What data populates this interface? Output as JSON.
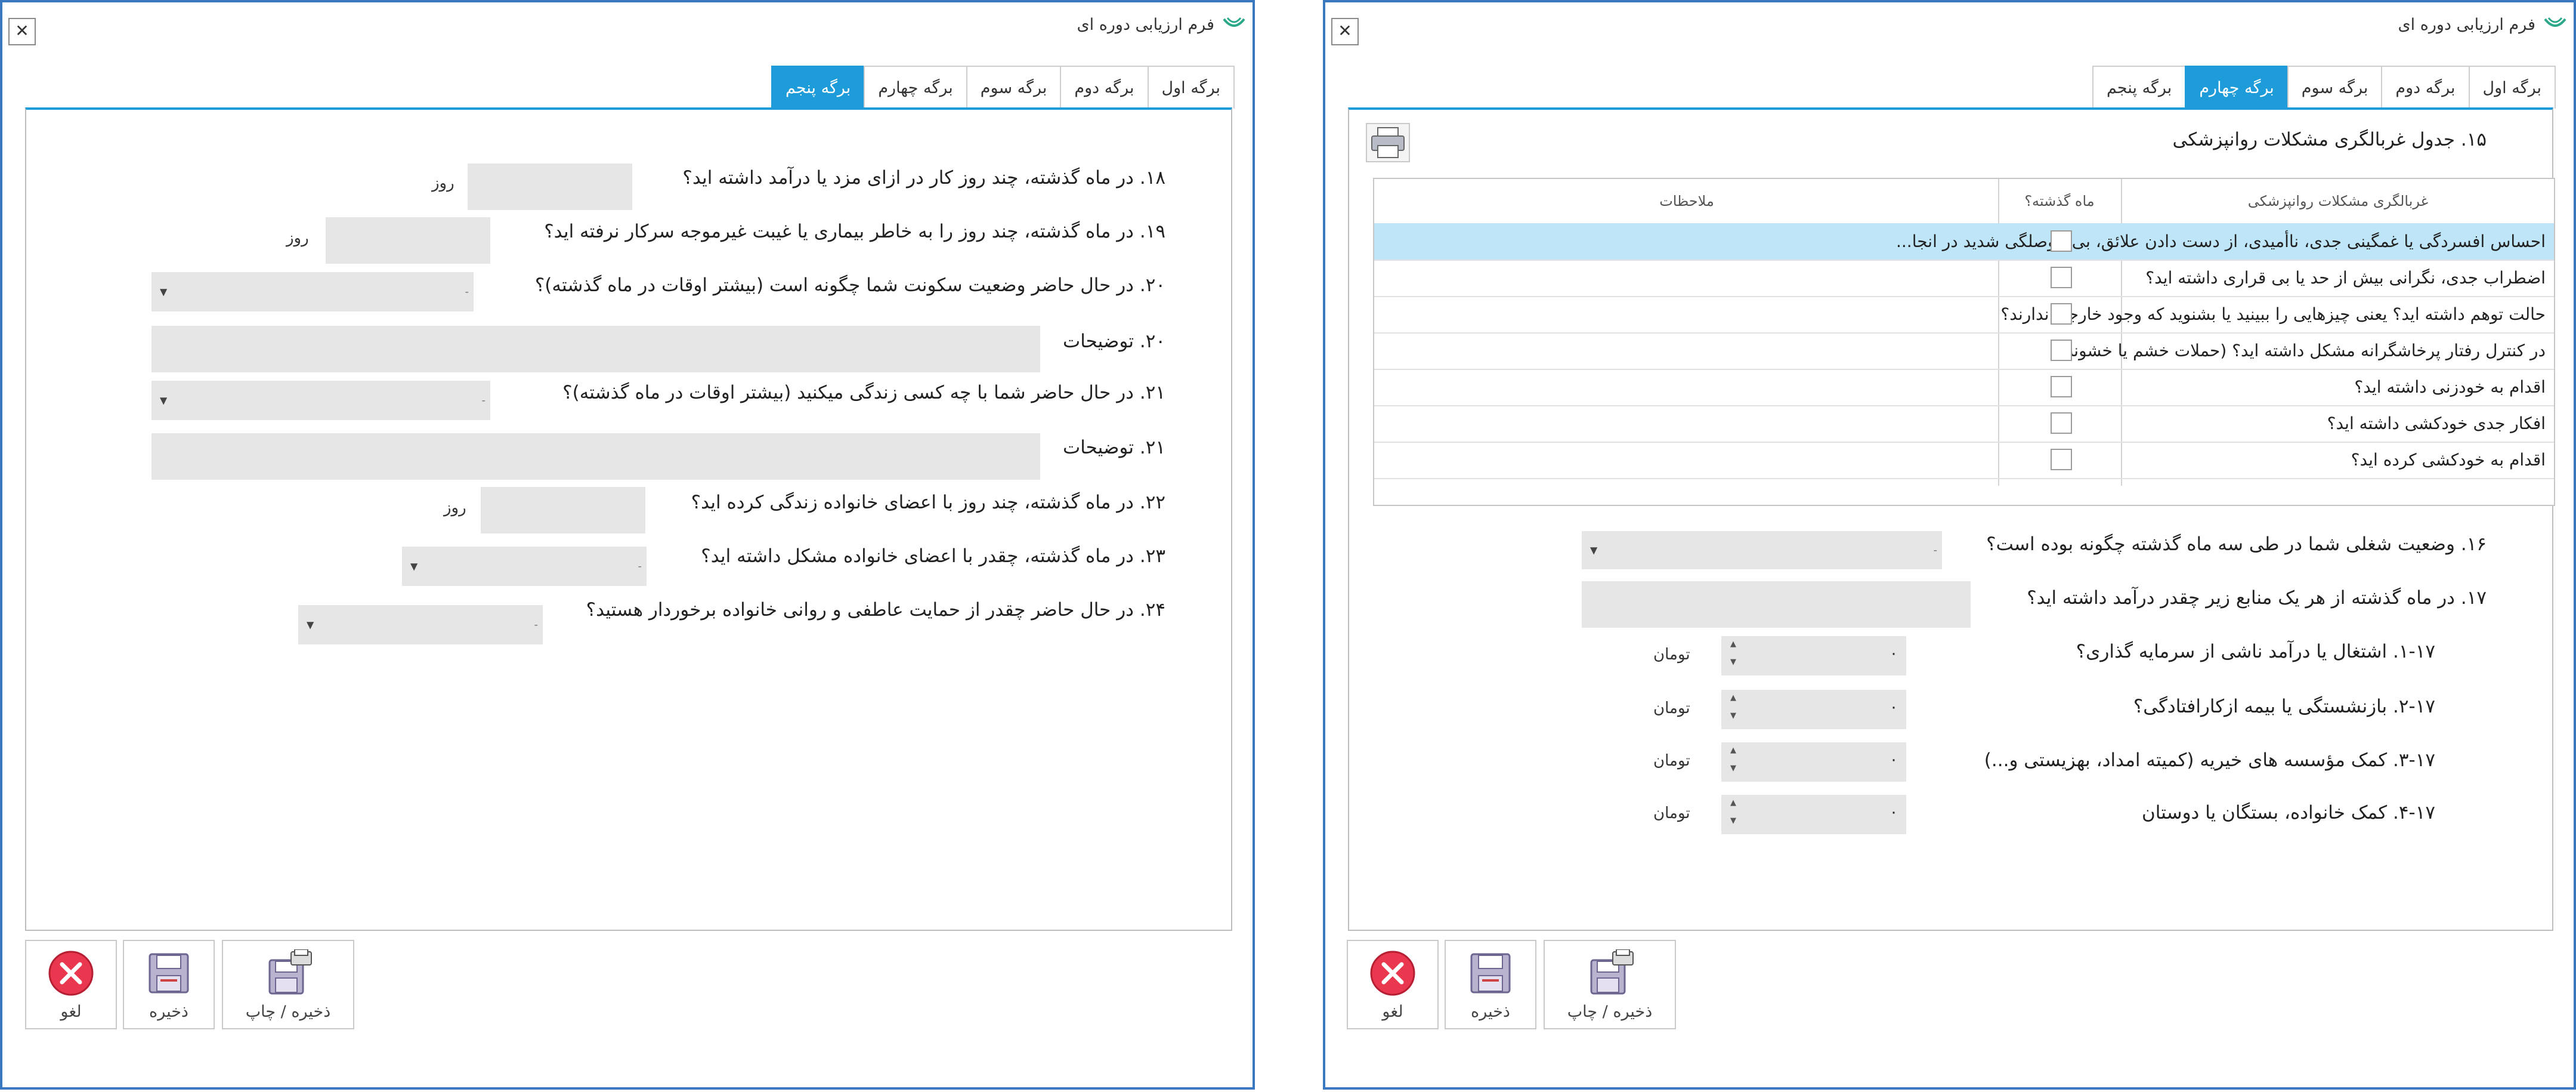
{
  "app": {
    "title": "فرم ارزیابی دوره ای",
    "close_label": "✕"
  },
  "tabs": [
    "برگه اول",
    "برگه دوم",
    "برگه سوم",
    "برگه چهارم",
    "برگه پنجم"
  ],
  "left": {
    "active_tab": "برگه پنجم",
    "questions": {
      "q18": "۱۸. در ماه گذشته، چند روز کار در ازای مزد یا درآمد داشته اید؟",
      "q19": "۱۹. در ماه گذشته، چند روز را به خاطر بیماری یا غیبت غیرموجه سرکار نرفته اید؟",
      "q20": "۲۰. در حال حاضر وضعیت سکونت شما چگونه است (بیشتر اوقات در ماه گذشته)؟",
      "q20_desc": "۲۰. توضیحات",
      "q21": "۲۱. در حال حاضر شما با چه کسی زندگی میکنید (بیشتر اوقات در ماه گذشته)؟",
      "q21_desc": "۲۱. توضیحات",
      "q22": "۲۲. در ماه گذشته، چند روز با اعضای خانواده زندگی کرده اید؟",
      "q23": "۲۳. در ماه گذشته، چقدر با اعضای خانواده مشکل داشته اید؟",
      "q24": "۲۴. در حال حاضر چقدر از حمایت عاطفی و روانی خانواده برخوردار هستید؟"
    },
    "unit_day": "روز"
  },
  "right": {
    "active_tab": "برگه چهارم",
    "q15": "۱۵. جدول غربالگری مشکلات روانپزشکی",
    "table": {
      "headers": [
        "غربالگری مشکلات روانپزشکی",
        "ماه گذشته؟",
        "ملاحظات"
      ],
      "rows": [
        "احساس افسردگی یا غمگینی جدی، ناأمیدی، از دست دادن علائق، بی حوصلگی شدید در انجا...",
        "اضطراب جدی، نگرانی بیش از حد یا بی قراری داشته اید؟",
        "حالت توهم داشته اید؟ یعنی چیزهایی را ببینید یا بشنوید که وجود خارجی ندارند؟",
        "در کنترل رفتار پرخاشگرانه مشکل داشته اید؟ (حملات خشم یا خشونت)",
        "اقدام به خودزنی داشته اید؟",
        "افکار جدی خودکشی داشته اید؟",
        "اقدام به خودکشی کرده اید؟"
      ]
    },
    "q16": "۱۶. وضعیت شغلی شما در طی سه ماه گذشته چگونه بوده است؟",
    "q17": "۱۷. در ماه گذشته از هر یک منابع زیر چقدر درآمد داشته اید؟",
    "q17_items": [
      "۱-۱۷. اشتغال یا درآمد ناشی از سرمایه گذاری؟",
      "۲-۱۷. بازنشستگی یا بیمه ازکارافتادگی؟",
      "۳-۱۷. کمک مؤسسه های خیریه (کمیته امداد، بهزیستی و...)",
      "۴-۱۷. کمک خانواده، بستگان یا دوستان"
    ],
    "amount_value": "۰",
    "unit_currency": "تومان"
  },
  "buttons": {
    "cancel": "لغو",
    "save": "ذخیره",
    "save_print": "ذخیره / چاپ"
  },
  "colors": {
    "accent": "#1e9bd9",
    "window_border": "#3a79c0",
    "selected_row": "#bfe6f8",
    "cancel_red": "#e8374e"
  }
}
